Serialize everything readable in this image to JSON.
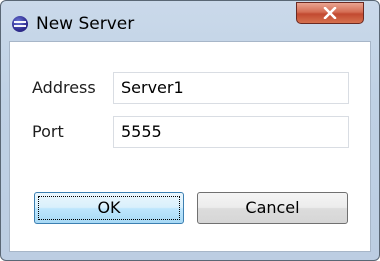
{
  "window": {
    "title": "New Server"
  },
  "titlebar": {
    "app_icon": "eclipse-icon",
    "close_icon": "close-icon"
  },
  "form": {
    "address_label": "Address",
    "address_value": "Server1",
    "port_label": "Port",
    "port_value": "5555"
  },
  "buttons": {
    "ok_label": "OK",
    "cancel_label": "Cancel"
  },
  "colors": {
    "close_button": "#c75035",
    "default_button_border": "#3c7fb1",
    "window_frame": "#c4d5e8"
  }
}
